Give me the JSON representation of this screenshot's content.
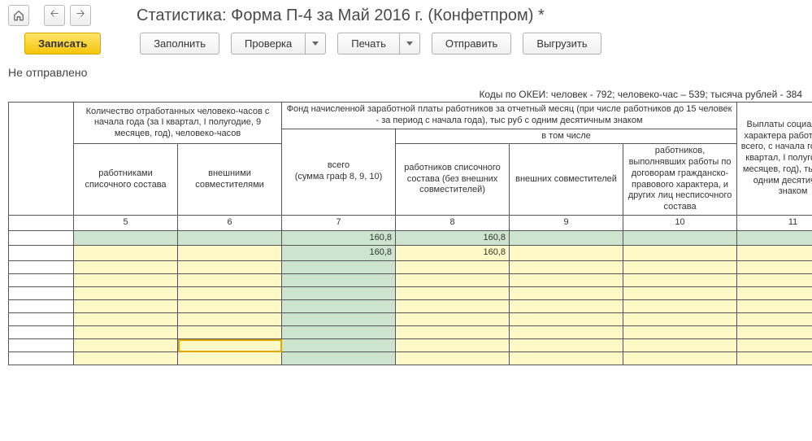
{
  "nav": {
    "home_title": "Главная",
    "back_title": "Назад",
    "forward_title": "Вперёд"
  },
  "title": "Статистика: Форма П-4 за Май 2016 г. (Конфетпром) *",
  "actions": {
    "save": "Записать",
    "fill": "Заполнить",
    "check": "Проверка",
    "print": "Печать",
    "send": "Отправить",
    "export": "Выгрузить"
  },
  "status": "Не отправлено",
  "codes": "Коды по ОКЕИ: человек - 792; человеко-час – 539; тысяча рублей - 384",
  "headers": {
    "h1": "Количество отработанных человеко-часов с начала года (за I квартал, I полугодие, 9 месяцев, год), человеко-часов",
    "h1a": "работниками списочного состава",
    "h1b": "внешними совместителями",
    "h2": "Фонд начисленной заработной платы работников за отчетный месяц (при числе работников до 15 человек - за период с начала года), тыс руб с одним десятичным знаком",
    "h2a": "всего\n(сумма граф 8, 9, 10)",
    "h2b": "в том числе",
    "h2b1": "работников списочного состава (без внешних совместителей)",
    "h2b2": "внешних совместителей",
    "h2b3": "работников, выполнявших работы по договорам гражданско-правового характера, и других лиц несписочного состава",
    "h3": "Выплаты социального характера работников - всего, с начала года (за I квартал, I полугодие, 9 месяцев, год), тыс руб с одним десятичным знаком"
  },
  "colnums": {
    "c5": "5",
    "c6": "6",
    "c7": "7",
    "c8": "8",
    "c9": "9",
    "c10": "10",
    "c11": "11"
  },
  "rows": [
    {
      "c5": "",
      "c6": "",
      "c7": "160,8",
      "c8": "160,8",
      "c9": "",
      "c10": "",
      "c11": "",
      "style": "green"
    },
    {
      "c5": "",
      "c6": "",
      "c7": "160,8",
      "c8": "160,8",
      "c9": "",
      "c10": "",
      "c11": "",
      "style": "yellow-green"
    },
    {
      "c5": "",
      "c6": "",
      "c7": "",
      "c8": "",
      "c9": "",
      "c10": "",
      "c11": "",
      "style": "yellow-green"
    },
    {
      "c5": "",
      "c6": "",
      "c7": "",
      "c8": "",
      "c9": "",
      "c10": "",
      "c11": "",
      "style": "yellow-green"
    },
    {
      "c5": "",
      "c6": "",
      "c7": "",
      "c8": "",
      "c9": "",
      "c10": "",
      "c11": "",
      "style": "yellow-green"
    },
    {
      "c5": "",
      "c6": "",
      "c7": "",
      "c8": "",
      "c9": "",
      "c10": "",
      "c11": "",
      "style": "yellow-green"
    },
    {
      "c5": "",
      "c6": "",
      "c7": "",
      "c8": "",
      "c9": "",
      "c10": "",
      "c11": "",
      "style": "yellow-green"
    },
    {
      "c5": "",
      "c6": "",
      "c7": "",
      "c8": "",
      "c9": "",
      "c10": "",
      "c11": "",
      "style": "yellow-green"
    },
    {
      "c5": "",
      "c6": "",
      "c7": "",
      "c8": "",
      "c9": "",
      "c10": "",
      "c11": "",
      "style": "yellow-green",
      "selected": "c6"
    },
    {
      "c5": "",
      "c6": "",
      "c7": "",
      "c8": "",
      "c9": "",
      "c10": "",
      "c11": "",
      "style": "yellow-green"
    }
  ]
}
